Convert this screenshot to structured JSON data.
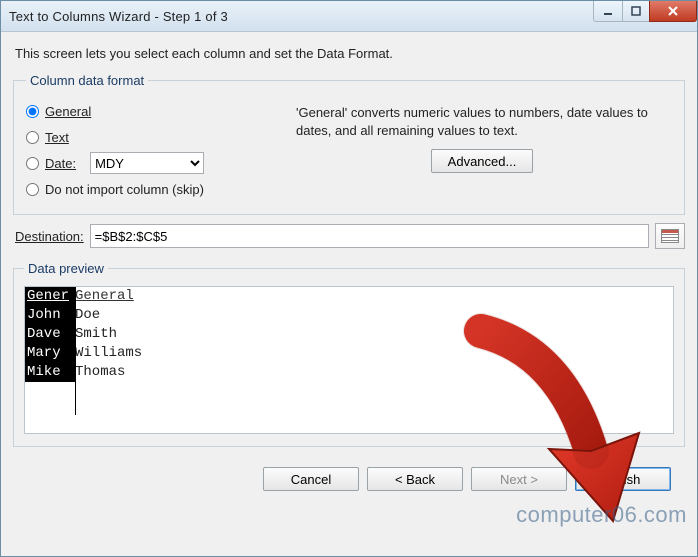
{
  "title": "Text to Columns Wizard - Step 1 of 3",
  "instruction": "This screen lets you select each column and set the Data Format.",
  "format_group": {
    "legend": "Column data format",
    "options": {
      "general": "General",
      "text": "Text",
      "date": "Date:",
      "skip": "Do not import column (skip)"
    },
    "date_order_selected": "MDY",
    "hint": "'General' converts numeric values to numbers, date values to dates, and all remaining values to text.",
    "advanced": "Advanced..."
  },
  "destination": {
    "label": "Destination:",
    "value": "=$B$2:$C$5"
  },
  "preview": {
    "legend": "Data preview",
    "headers": [
      "General",
      "General"
    ],
    "rows": [
      [
        "John",
        "Doe"
      ],
      [
        "Dave",
        "Smith"
      ],
      [
        "Mary",
        "Williams"
      ],
      [
        "Mike",
        "Thomas"
      ]
    ]
  },
  "buttons": {
    "cancel": "Cancel",
    "back": "< Back",
    "next": "Next >",
    "finish": "Finish"
  },
  "watermark": "computer06.com"
}
